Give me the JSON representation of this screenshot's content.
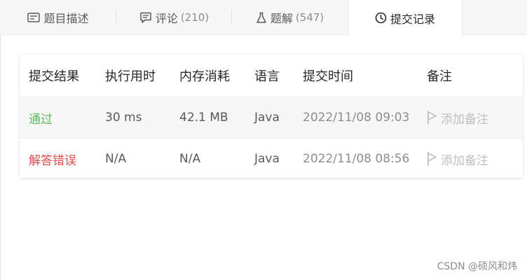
{
  "tabs": [
    {
      "label": "题目描述",
      "count": "",
      "icon": "description-icon"
    },
    {
      "label": "评论",
      "count": "(210)",
      "icon": "comment-icon"
    },
    {
      "label": "题解",
      "count": "(547)",
      "icon": "flask-icon"
    },
    {
      "label": "提交记录",
      "count": "",
      "icon": "clock-icon"
    }
  ],
  "table": {
    "headers": [
      "提交结果",
      "执行用时",
      "内存消耗",
      "语言",
      "提交时间",
      "备注"
    ],
    "rows": [
      {
        "result": "通过",
        "runtime": "30 ms",
        "memory": "42.1 MB",
        "language": "Java",
        "time": "2022/11/08 09:03",
        "note": "添加备注"
      },
      {
        "result": "解答错误",
        "runtime": "N/A",
        "memory": "N/A",
        "language": "Java",
        "time": "2022/11/08 08:56",
        "note": "添加备注"
      }
    ]
  },
  "watermark": "CSDN @硕风和炜",
  "colors": {
    "pass": "#5cb85c",
    "fail": "#e04d4d",
    "muted": "#bfbfbf"
  }
}
